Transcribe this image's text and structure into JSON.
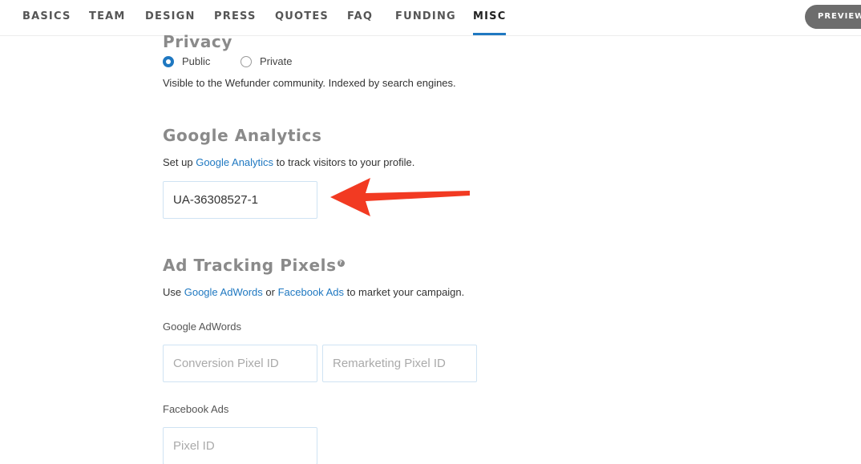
{
  "nav": {
    "tabs": [
      {
        "label": "BASICS"
      },
      {
        "label": "TEAM"
      },
      {
        "label": "DESIGN"
      },
      {
        "label": "PRESS"
      },
      {
        "label": "QUOTES"
      },
      {
        "label": "FAQ"
      },
      {
        "label": "FUNDING"
      },
      {
        "label": "MISC",
        "active": true
      }
    ],
    "preview_label": "PREVIEW"
  },
  "privacy": {
    "title": "Privacy",
    "options": [
      {
        "label": "Public",
        "selected": true
      },
      {
        "label": "Private",
        "selected": false
      }
    ],
    "description": "Visible to the Wefunder community. Indexed by search engines."
  },
  "google_analytics": {
    "title": "Google Analytics",
    "desc_prefix": "Set up ",
    "desc_link": "Google Analytics",
    "desc_suffix": " to track visitors to your profile.",
    "input_value": "UA-36308527-1"
  },
  "ad_tracking": {
    "title": "Ad Tracking Pixels",
    "help_glyph": "?",
    "desc_prefix": "Use ",
    "link_adwords": "Google AdWords",
    "desc_middle": " or ",
    "link_facebook": "Facebook Ads",
    "desc_suffix": " to market your campaign.",
    "adwords_label": "Google AdWords",
    "conversion_placeholder": "Conversion Pixel ID",
    "remarketing_placeholder": "Remarketing Pixel ID",
    "facebook_label": "Facebook Ads",
    "pixel_placeholder": "Pixel ID"
  },
  "colors": {
    "accent": "#1f78c1",
    "annotation_arrow": "#f23a22",
    "heading_gray": "#8a8a8a"
  }
}
